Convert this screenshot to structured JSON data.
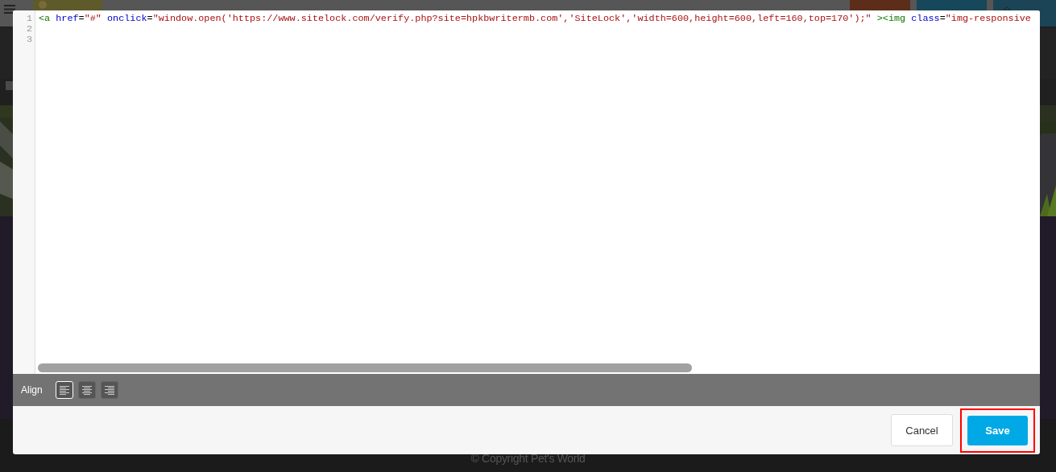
{
  "page": {
    "header_buttons": [
      {
        "kind": "save"
      },
      {
        "kind": "publish"
      },
      {
        "kind": "upgrade"
      }
    ],
    "footer": "© Copyright Pet's World"
  },
  "dialog": {
    "editor": {
      "line_numbers": [
        "1",
        "2",
        "3"
      ],
      "lines": [
        [
          {
            "kind": "tag",
            "text": "<a"
          },
          {
            "kind": "attribute",
            "text": " href"
          },
          {
            "kind": "text",
            "text": "="
          },
          {
            "kind": "string",
            "text": "\"#\""
          },
          {
            "kind": "attribute",
            "text": " onclick"
          },
          {
            "kind": "text",
            "text": "="
          },
          {
            "kind": "string",
            "text": "\"window.open('https://www.sitelock.com/verify.php?site=hpkbwritermb.com','SiteLock','width=600,height=600,left=160,top=170');\""
          },
          {
            "kind": "tag",
            "text": " ><img"
          },
          {
            "kind": "attribute",
            "text": " class"
          },
          {
            "kind": "text",
            "text": "="
          },
          {
            "kind": "string",
            "text": "\"img-responsive"
          }
        ]
      ]
    },
    "align": {
      "label": "Align",
      "options": [
        {
          "kind": "left",
          "selected": true
        },
        {
          "kind": "center",
          "selected": false
        },
        {
          "kind": "right",
          "selected": false
        }
      ]
    },
    "buttons": [
      {
        "label": "Cancel",
        "kind": "secondary",
        "highlighted": false
      },
      {
        "label": "Save",
        "kind": "primary",
        "highlighted": true
      }
    ]
  }
}
